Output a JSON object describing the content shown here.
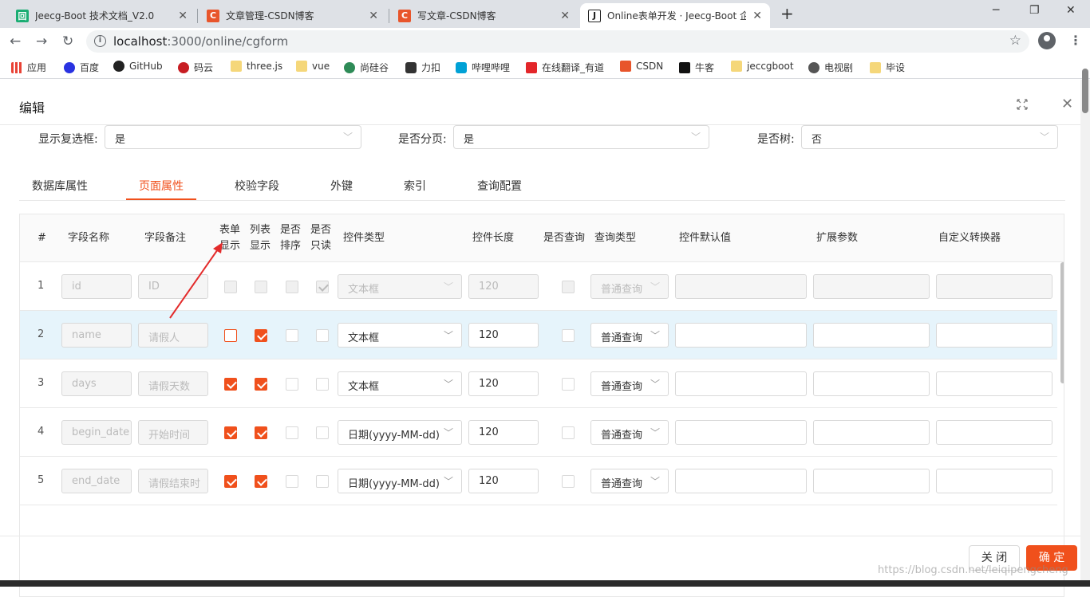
{
  "browser": {
    "tabs": [
      {
        "title": "Jeecg-Boot 技术文档_V2.0",
        "icon": "jeecg-doc-icon",
        "color": "#1aad73"
      },
      {
        "title": "文章管理-CSDN博客",
        "icon": "csdn-icon",
        "color": "#e8552b"
      },
      {
        "title": "写文章-CSDN博客",
        "icon": "csdn-icon",
        "color": "#e8552b"
      },
      {
        "title": "Online表单开发 · Jeecg-Boot 企",
        "icon": "jeecg-j-icon",
        "color": "#222222"
      }
    ],
    "url_host": "localhost",
    "url_rest": ":3000/online/cgform",
    "bookmarks": [
      {
        "label": "应用",
        "color": "#e94235"
      },
      {
        "label": "百度",
        "color": "#2932e1"
      },
      {
        "label": "GitHub",
        "color": "#222222"
      },
      {
        "label": "码云",
        "color": "#c71d23"
      },
      {
        "label": "three.js",
        "color": "#f5c542"
      },
      {
        "label": "vue",
        "color": "#f5c542"
      },
      {
        "label": "尚硅谷",
        "color": "#2e8b57"
      },
      {
        "label": "力扣",
        "color": "#333333"
      },
      {
        "label": "哔哩哔哩",
        "color": "#00a1d6"
      },
      {
        "label": "在线翻译_有道",
        "color": "#e3262a"
      },
      {
        "label": "CSDN",
        "color": "#e8552b"
      },
      {
        "label": "牛客",
        "color": "#111111"
      },
      {
        "label": "jeccgboot",
        "color": "#f5c542"
      },
      {
        "label": "电视剧",
        "color": "#555555"
      },
      {
        "label": "毕设",
        "color": "#f5c542"
      }
    ]
  },
  "modal": {
    "title": "编辑",
    "form": {
      "show_checkbox_label": "显示复选框:",
      "show_checkbox_value": "是",
      "paging_label": "是否分页:",
      "paging_value": "是",
      "tree_label": "是否树:",
      "tree_value": "否"
    },
    "tabs": [
      "数据库属性",
      "页面属性",
      "校验字段",
      "外键",
      "索引",
      "查询配置"
    ],
    "active_tab": "页面属性",
    "columns": {
      "num": "#",
      "field_name": "字段名称",
      "field_remark": "字段备注",
      "form_show_1": "表单",
      "form_show_2": "显示",
      "list_show_1": "列表",
      "list_show_2": "显示",
      "sort_1": "是否",
      "sort_2": "排序",
      "readonly_1": "是否",
      "readonly_2": "只读",
      "control_type": "控件类型",
      "control_len": "控件长度",
      "is_query": "是否查询",
      "query_type": "查询类型",
      "default_val": "控件默认值",
      "ext_params": "扩展参数",
      "converter": "自定义转换器"
    },
    "rows": [
      {
        "num": "1",
        "name": "id",
        "remark": "ID",
        "form_show": false,
        "list_show": false,
        "sort": false,
        "readonly": true,
        "control": "文本框",
        "len": "120",
        "query": "普通查询",
        "disabled": true
      },
      {
        "num": "2",
        "name": "name",
        "remark": "请假人",
        "form_show": false,
        "list_show": true,
        "sort": false,
        "readonly": false,
        "control": "文本框",
        "len": "120",
        "query": "普通查询",
        "disabled": false
      },
      {
        "num": "3",
        "name": "days",
        "remark": "请假天数",
        "form_show": true,
        "list_show": true,
        "sort": false,
        "readonly": false,
        "control": "文本框",
        "len": "120",
        "query": "普通查询",
        "disabled": false
      },
      {
        "num": "4",
        "name": "begin_date",
        "remark": "开始时间",
        "form_show": true,
        "list_show": true,
        "sort": false,
        "readonly": false,
        "control": "日期(yyyy-MM-dd)",
        "len": "120",
        "query": "普通查询",
        "disabled": false
      },
      {
        "num": "5",
        "name": "end_date",
        "remark": "请假结束时",
        "form_show": true,
        "list_show": true,
        "sort": false,
        "readonly": false,
        "control": "日期(yyyy-MM-dd)",
        "len": "120",
        "query": "普通查询",
        "disabled": false
      }
    ],
    "buttons": {
      "close": "关 闭",
      "ok": "确 定"
    },
    "accent": "#f0501c"
  },
  "watermark": "https://blog.csdn.net/leiqipengcheng"
}
